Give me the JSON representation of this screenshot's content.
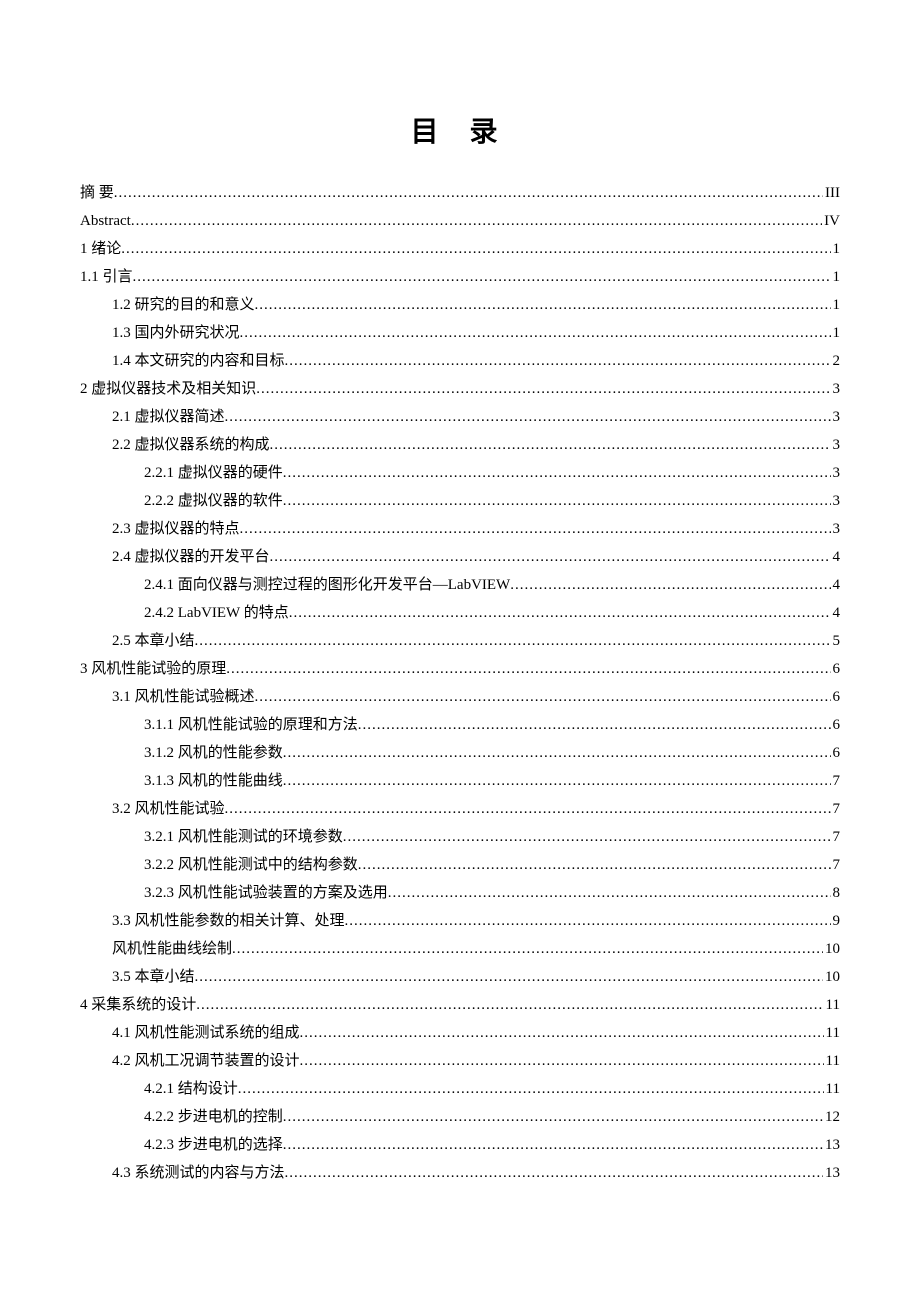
{
  "title": "目  录",
  "entries": [
    {
      "text": "摘   要",
      "page": "III",
      "indent": 0
    },
    {
      "text": "Abstract",
      "page": "IV",
      "indent": 0
    },
    {
      "text": "1  绪论",
      "page": "1",
      "indent": 0
    },
    {
      "text": "1.1  引言",
      "page": "1",
      "indent": 0
    },
    {
      "text": "1.2  研究的目的和意义",
      "page": "1",
      "indent": 1
    },
    {
      "text": "1.3  国内外研究状况",
      "page": "1",
      "indent": 1
    },
    {
      "text": "1.4  本文研究的内容和目标",
      "page": "2",
      "indent": 1
    },
    {
      "text": "2  虚拟仪器技术及相关知识",
      "page": "3",
      "indent": 0
    },
    {
      "text": "2.1  虚拟仪器简述",
      "page": "3",
      "indent": 1
    },
    {
      "text": "2.2  虚拟仪器系统的构成",
      "page": "3",
      "indent": 1
    },
    {
      "text": "2.2.1  虚拟仪器的硬件",
      "page": "3",
      "indent": 2
    },
    {
      "text": "2.2.2  虚拟仪器的软件",
      "page": "3",
      "indent": 2
    },
    {
      "text": "2.3  虚拟仪器的特点",
      "page": "3",
      "indent": 1
    },
    {
      "text": "2.4  虚拟仪器的开发平台",
      "page": "4",
      "indent": 1
    },
    {
      "text": "2.4.1  面向仪器与测控过程的图形化开发平台—LabVIEW",
      "page": "4",
      "indent": 2
    },
    {
      "text": "2.4.2   LabVIEW  的特点",
      "page": "4",
      "indent": 2
    },
    {
      "text": "2.5  本章小结",
      "page": "5",
      "indent": 1
    },
    {
      "text": "3  风机性能试验的原理",
      "page": "6",
      "indent": 0
    },
    {
      "text": "3.1  风机性能试验概述",
      "page": "6",
      "indent": 1
    },
    {
      "text": "3.1.1  风机性能试验的原理和方法",
      "page": "6",
      "indent": 2
    },
    {
      "text": "3.1.2  风机的性能参数",
      "page": "6",
      "indent": 2
    },
    {
      "text": "3.1.3  风机的性能曲线",
      "page": "7",
      "indent": 2
    },
    {
      "text": "3.2  风机性能试验",
      "page": "7",
      "indent": 1
    },
    {
      "text": "3.2.1  风机性能测试的环境参数",
      "page": "7",
      "indent": 2
    },
    {
      "text": "3.2.2  风机性能测试中的结构参数",
      "page": "7",
      "indent": 2
    },
    {
      "text": "3.2.3  风机性能试验装置的方案及选用",
      "page": "8",
      "indent": 2
    },
    {
      "text": "3.3  风机性能参数的相关计算、处理",
      "page": "9",
      "indent": 1
    },
    {
      "text": "风机性能曲线绘制",
      "page": "10",
      "indent": 1
    },
    {
      "text": "3.5  本章小结",
      "page": "10",
      "indent": 1
    },
    {
      "text": "4 采集系统的设计",
      "page": "11",
      "indent": 0
    },
    {
      "text": "4.1  风机性能测试系统的组成",
      "page": "11",
      "indent": 1
    },
    {
      "text": "4.2  风机工况调节装置的设计",
      "page": "11",
      "indent": 1
    },
    {
      "text": "4.2.1  结构设计",
      "page": "11",
      "indent": 2
    },
    {
      "text": "4.2.2  步进电机的控制",
      "page": "12",
      "indent": 2
    },
    {
      "text": "4.2.3  步进电机的选择",
      "page": "13",
      "indent": 2
    },
    {
      "text": "4.3  系统测试的内容与方法",
      "page": "13",
      "indent": 1
    }
  ]
}
